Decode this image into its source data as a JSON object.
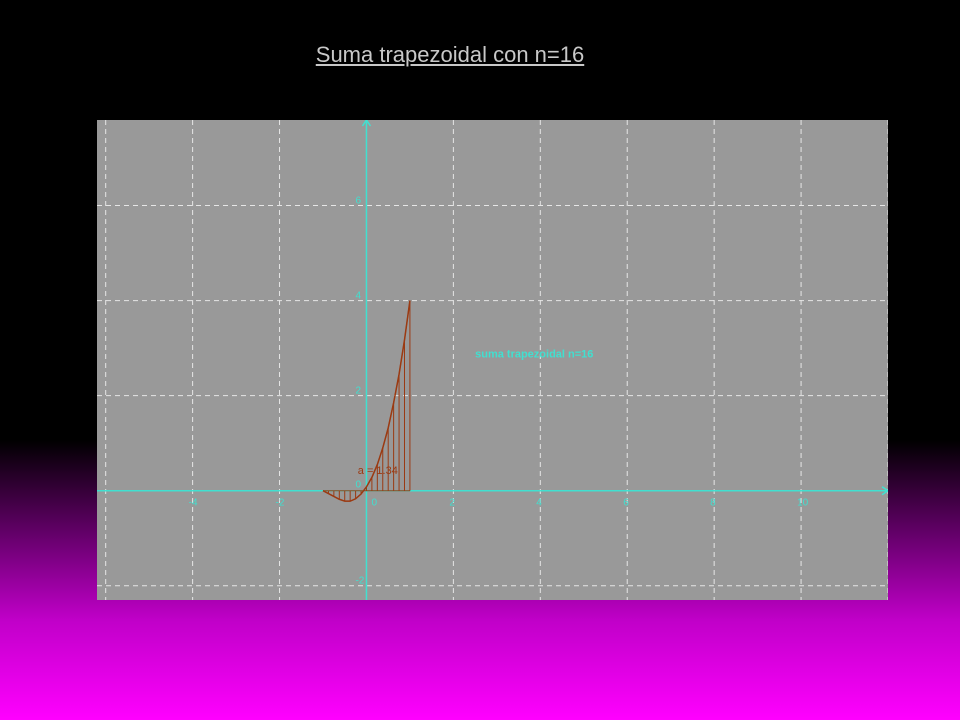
{
  "slide": {
    "title": "Suma trapezoidal con n=16"
  },
  "colors": {
    "background_top": "#000000",
    "background_bottom": "#ff00ff",
    "title_text": "#c8c8c8",
    "panel_background": "#999999",
    "axis": "#40e0d0",
    "grid": "#e6e6e6",
    "curve": "#9b3a12"
  },
  "chart_data": {
    "type": "line",
    "function_samples": {
      "x": [
        -1,
        -0.875,
        -0.75,
        -0.625,
        -0.5,
        -0.375,
        -0.25,
        -0.125,
        0,
        0.125,
        0.25,
        0.375,
        0.5,
        0.625,
        0.75,
        0.875,
        1
      ],
      "y": [
        0,
        -0.06,
        -0.12,
        -0.18,
        -0.22,
        -0.22,
        -0.17,
        -0.07,
        0.08,
        0.28,
        0.55,
        0.9,
        1.32,
        1.85,
        2.45,
        3.17,
        4
      ]
    },
    "trapezoid_count": 16,
    "interval": [
      -1,
      1
    ],
    "x_ticks": [
      -4,
      -2,
      0,
      2,
      4,
      6,
      8,
      10
    ],
    "y_ticks": [
      -2,
      0,
      2,
      4,
      6
    ],
    "xlim": [
      -6.2,
      12.0
    ],
    "ylim": [
      -2.3,
      7.8
    ],
    "grid": true,
    "annotations": {
      "method_label": "suma trapezoidal n=16",
      "area_label": "a = 1.34"
    }
  }
}
